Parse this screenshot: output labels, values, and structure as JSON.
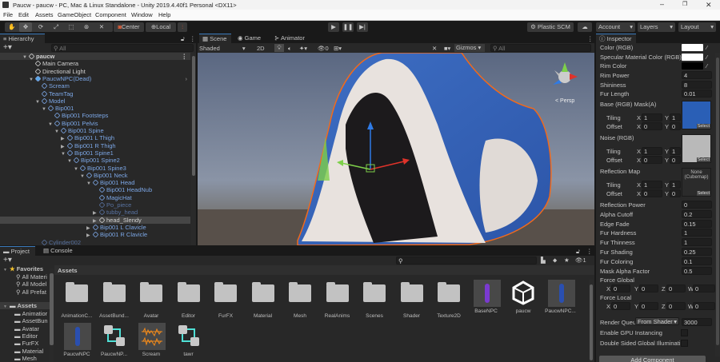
{
  "window": {
    "title": "Paucw - paucw - PC, Mac & Linux Standalone - Unity 2019.4.40f1 Personal <DX11>",
    "minimize": "–",
    "restore": "❐",
    "close": "✕"
  },
  "menu": [
    "File",
    "Edit",
    "Assets",
    "GameObject",
    "Component",
    "Window",
    "Help"
  ],
  "toolbar": {
    "center": "Center",
    "local": "Local",
    "plastic": "Plastic SCM",
    "account": "Account",
    "layers": "Layers",
    "layout": "Layout",
    "tools": [
      "hand-tool",
      "move-tool",
      "rotate-tool",
      "scale-tool",
      "rect-tool",
      "transform-tool",
      "custom-tool"
    ]
  },
  "hierarchy": {
    "tab": "Hierarchy",
    "search_placeholder": "All",
    "items": [
      {
        "label": "paucw",
        "depth": 0,
        "arrow": "open",
        "style": "white",
        "scene": true
      },
      {
        "label": "Main Camera",
        "depth": 1,
        "arrow": "",
        "style": "white"
      },
      {
        "label": "Directional Light",
        "depth": 1,
        "arrow": "",
        "style": "white"
      },
      {
        "label": "PaucwNPC(Dead)",
        "depth": 1,
        "arrow": "open",
        "style": "blue",
        "prefab": true
      },
      {
        "label": "Scream",
        "depth": 2,
        "arrow": "",
        "style": "blue"
      },
      {
        "label": "TeamTag",
        "depth": 2,
        "arrow": "",
        "style": "blue"
      },
      {
        "label": "Model",
        "depth": 2,
        "arrow": "open",
        "style": "blue"
      },
      {
        "label": "Bip001",
        "depth": 3,
        "arrow": "open",
        "style": "blue"
      },
      {
        "label": "Bip001 Footsteps",
        "depth": 4,
        "arrow": "",
        "style": "blue"
      },
      {
        "label": "Bip001 Pelvis",
        "depth": 4,
        "arrow": "open",
        "style": "blue"
      },
      {
        "label": "Bip001 Spine",
        "depth": 5,
        "arrow": "open",
        "style": "blue"
      },
      {
        "label": "Bip001 L Thigh",
        "depth": 6,
        "arrow": "closed",
        "style": "blue"
      },
      {
        "label": "Bip001 R Thigh",
        "depth": 6,
        "arrow": "closed",
        "style": "blue"
      },
      {
        "label": "Bip001 Spine1",
        "depth": 6,
        "arrow": "open",
        "style": "blue"
      },
      {
        "label": "Bip001 Spine2",
        "depth": 7,
        "arrow": "open",
        "style": "blue"
      },
      {
        "label": "Bip001 Spine3",
        "depth": 8,
        "arrow": "open",
        "style": "blue"
      },
      {
        "label": "Bip001 Neck",
        "depth": 9,
        "arrow": "open",
        "style": "blue"
      },
      {
        "label": "Bip001 Head",
        "depth": 10,
        "arrow": "open",
        "style": "blue"
      },
      {
        "label": "Bip001 HeadNub",
        "depth": 11,
        "arrow": "",
        "style": "blue"
      },
      {
        "label": "MagicHat",
        "depth": 11,
        "arrow": "",
        "style": "blue"
      },
      {
        "label": "Po_piece",
        "depth": 11,
        "arrow": "",
        "style": "dim"
      },
      {
        "label": "tubby_head",
        "depth": 11,
        "arrow": "closed",
        "style": "dim"
      },
      {
        "label": "head_Slendy",
        "depth": 11,
        "arrow": "closed",
        "style": "white",
        "selected": true
      },
      {
        "label": "Bip001 L Clavicle",
        "depth": 10,
        "arrow": "closed",
        "style": "blue"
      },
      {
        "label": "Bip001 R Clavicle",
        "depth": 10,
        "arrow": "closed",
        "style": "blue"
      },
      {
        "label": "Cylinder002",
        "depth": 2,
        "arrow": "",
        "style": "dim"
      }
    ]
  },
  "scene": {
    "tabs": [
      "Scene",
      "Game",
      "Animator"
    ],
    "shading": "Shaded",
    "mode2d": "2D",
    "hidden_count": "0",
    "gizmos": "Gizmos",
    "search_placeholder": "All",
    "persp": "< Persp"
  },
  "inspector": {
    "tab": "Inspector",
    "colors": [
      {
        "label": "Color (RGB)",
        "value": "#ffffff"
      },
      {
        "label": "Specular Material Color (RGB)",
        "value": "#ffffff"
      },
      {
        "label": "Rim Color",
        "value": "#000000"
      }
    ],
    "floats1": [
      {
        "label": "Rim Power",
        "value": "4"
      },
      {
        "label": "Shininess",
        "value": "8"
      },
      {
        "label": "Fur Length",
        "value": "0.01"
      }
    ],
    "textures": [
      {
        "label": "Base (RGB) Mask(A)",
        "tiling": [
          "1",
          "1"
        ],
        "offset": [
          "0",
          "0"
        ],
        "select": "Select",
        "none": ""
      },
      {
        "label": "Noise (RGB)",
        "tiling": [
          "1",
          "1"
        ],
        "offset": [
          "0",
          "0"
        ],
        "select": "Select",
        "none": ""
      },
      {
        "label": "Reflection Map",
        "tiling": [
          "1",
          "1"
        ],
        "offset": [
          "0",
          "0"
        ],
        "select": "Select",
        "none": "None (Cubemap)"
      }
    ],
    "tiling": "Tiling",
    "offset": "Offset",
    "x": "X",
    "y": "Y",
    "z": "Z",
    "w": "W",
    "floats2": [
      {
        "label": "Reflection Power",
        "value": "0"
      },
      {
        "label": "Alpha Cutoff",
        "value": "0.2"
      },
      {
        "label": "Edge Fade",
        "value": "0.15"
      },
      {
        "label": "Fur Hardness",
        "value": "1"
      },
      {
        "label": "Fur Thinness",
        "value": "1"
      },
      {
        "label": "Fur Shading",
        "value": "0.25"
      },
      {
        "label": "Fur Coloring",
        "value": "0.1"
      },
      {
        "label": "Mask Alpha Factor",
        "value": "0.5"
      }
    ],
    "force_global": {
      "label": "Force Global",
      "values": [
        "0",
        "0",
        "0",
        "0"
      ]
    },
    "force_local": {
      "label": "Force Local",
      "values": [
        "0",
        "0",
        "0",
        "0"
      ]
    },
    "render_queue": {
      "label": "Render Queu",
      "mode": "From Shader",
      "value": "3000"
    },
    "gpu_instancing": {
      "label": "Enable GPU Instancing",
      "checked": false
    },
    "double_sided": {
      "label": "Double Sided Global Illuminati",
      "checked": false
    },
    "add_component": "Add Component"
  },
  "project": {
    "tabs": [
      "Project",
      "Console"
    ],
    "hidden_count": "1",
    "breadcrumb": "Assets",
    "favorites": {
      "label": "Favorites",
      "items": [
        "All Materi",
        "All Model",
        "All Prefat"
      ]
    },
    "assets_tree": {
      "label": "Assets",
      "items": [
        "Animatior",
        "AssetBun",
        "Avatar",
        "Editor",
        "FurFX",
        "Material",
        "Mesh"
      ]
    },
    "assets": [
      {
        "name": "AnimationC...",
        "type": "folder"
      },
      {
        "name": "AssetBund...",
        "type": "folder"
      },
      {
        "name": "Avatar",
        "type": "folder"
      },
      {
        "name": "Editor",
        "type": "folder"
      },
      {
        "name": "FurFX",
        "type": "folder"
      },
      {
        "name": "Material",
        "type": "folder"
      },
      {
        "name": "Mesh",
        "type": "folder"
      },
      {
        "name": "RealAnims",
        "type": "folder"
      },
      {
        "name": "Scenes",
        "type": "folder"
      },
      {
        "name": "Shader",
        "type": "folder"
      },
      {
        "name": "Texture2D",
        "type": "folder"
      },
      {
        "name": "BaseNPC",
        "type": "prefab-purple"
      },
      {
        "name": "paucw",
        "type": "unity-scene"
      },
      {
        "name": "PaucwNPC...",
        "type": "prefab-blue"
      },
      {
        "name": "PaucwNPC",
        "type": "prefab-blue"
      },
      {
        "name": "PaucwNP...",
        "type": "prefab-variant"
      },
      {
        "name": "Scream",
        "type": "audio"
      },
      {
        "name": "tawr",
        "type": "prefab-variant"
      }
    ]
  },
  "colors": {
    "accent": "#3a79bb",
    "prefab_text": "#7ca7e6",
    "outline": "#f26a1b"
  }
}
